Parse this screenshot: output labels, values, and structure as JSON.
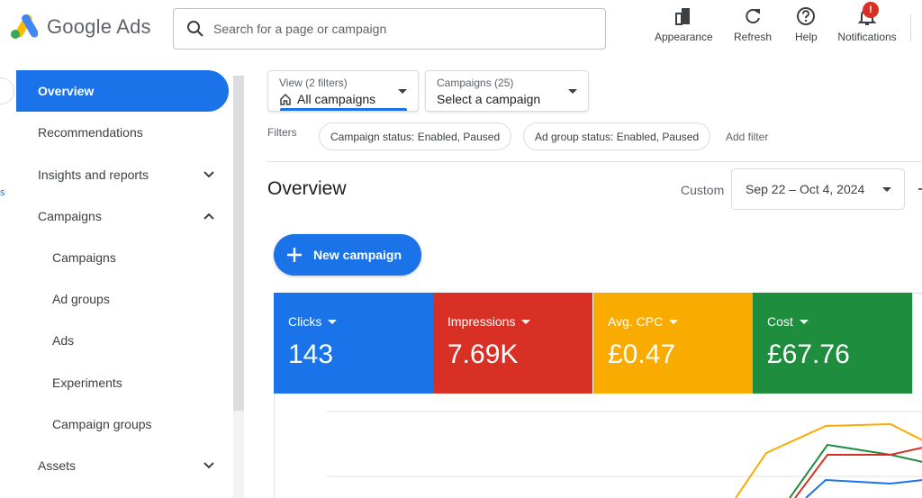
{
  "header": {
    "app_name": "Google Ads",
    "search_placeholder": "Search for a page or campaign",
    "buttons": [
      {
        "label": "Appearance",
        "icon": "appearance-icon"
      },
      {
        "label": "Refresh",
        "icon": "refresh-icon"
      },
      {
        "label": "Help",
        "icon": "help-icon"
      },
      {
        "label": "Notifications",
        "icon": "bell-icon",
        "badge": "!"
      }
    ],
    "badge_color": "#d93025"
  },
  "left_rail": {
    "fragment": "s"
  },
  "sidebar": {
    "items": [
      {
        "label": "Overview",
        "active": true
      },
      {
        "label": "Recommendations"
      },
      {
        "label": "Insights and reports",
        "chevron": "chevron-down-icon"
      },
      {
        "label": "Campaigns",
        "chevron": "chevron-up-icon"
      },
      {
        "label": "Campaigns",
        "sub": true
      },
      {
        "label": "Ad groups",
        "sub": true
      },
      {
        "label": "Ads",
        "sub": true
      },
      {
        "label": "Experiments",
        "sub": true
      },
      {
        "label": "Campaign groups",
        "sub": true
      },
      {
        "label": "Assets",
        "chevron": "chevron-down-icon"
      }
    ],
    "active_color": "#1a73e8"
  },
  "view_selector": {
    "small": "View (2 filters)",
    "main": "All campaigns"
  },
  "campaign_selector": {
    "small": "Campaigns (25)",
    "main": "Select a campaign"
  },
  "filters": {
    "label": "Filters",
    "chips": [
      "Campaign status: Enabled, Paused",
      "Ad group status: Enabled, Paused"
    ],
    "add": "Add filter"
  },
  "page": {
    "title": "Overview",
    "custom_label": "Custom",
    "date_range": "Sep 22 – Oct 4, 2024"
  },
  "new_campaign": {
    "label": "New campaign"
  },
  "metrics": [
    {
      "label": "Clicks",
      "value": "143",
      "color": "#1a73e8"
    },
    {
      "label": "Impressions",
      "value": "7.69K",
      "color": "#d93025"
    },
    {
      "label": "Avg. CPC",
      "value": "£0.47",
      "color": "#f9ab00"
    },
    {
      "label": "Cost",
      "value": "£67.76",
      "color": "#1e8e3e"
    }
  ]
}
